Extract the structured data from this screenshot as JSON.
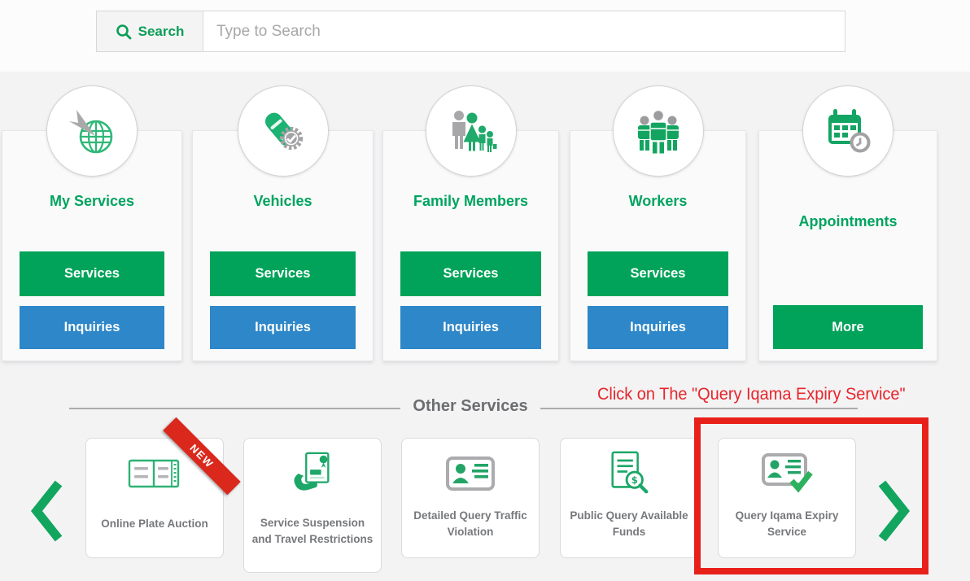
{
  "search": {
    "label": "Search",
    "placeholder": "Type to Search",
    "icon": "magnifier-icon"
  },
  "categories": [
    {
      "title": "My Services",
      "icon": "globe-cursor-icon",
      "buttons": [
        {
          "label": "Services"
        },
        {
          "label": "Inquiries"
        }
      ]
    },
    {
      "title": "Vehicles",
      "icon": "car-check-icon",
      "buttons": [
        {
          "label": "Services"
        },
        {
          "label": "Inquiries"
        }
      ]
    },
    {
      "title": "Family Members",
      "icon": "family-icon",
      "buttons": [
        {
          "label": "Services"
        },
        {
          "label": "Inquiries"
        }
      ]
    },
    {
      "title": "Workers",
      "icon": "workers-icon",
      "buttons": [
        {
          "label": "Services"
        },
        {
          "label": "Inquiries"
        }
      ]
    },
    {
      "title": "Appointments",
      "icon": "calendar-clock-icon",
      "buttons": [
        {
          "label": "More"
        }
      ]
    }
  ],
  "other_services": {
    "heading": "Other Services",
    "annotation": "Click on The \"Query Iqama Expiry Service\"",
    "items": [
      {
        "label": "Online Plate Auction",
        "icon": "license-plate-icon",
        "badge": "NEW"
      },
      {
        "label": "Service Suspension and Travel Restrictions",
        "icon": "hand-document-icon"
      },
      {
        "label": "Detailed Query Traffic Violation",
        "icon": "id-card-icon"
      },
      {
        "label": "Public Query Available Funds",
        "icon": "document-search-dollar-icon"
      },
      {
        "label": "Query Iqama Expiry Service",
        "icon": "id-card-check-icon",
        "highlighted": true
      }
    ]
  },
  "colors": {
    "green": "#00a359",
    "blue": "#2d87c8",
    "annotation_red": "#e8252a",
    "ribbon_red": "#da291c",
    "label_gray": "#77787b",
    "heading_gray": "#6d6e71"
  }
}
